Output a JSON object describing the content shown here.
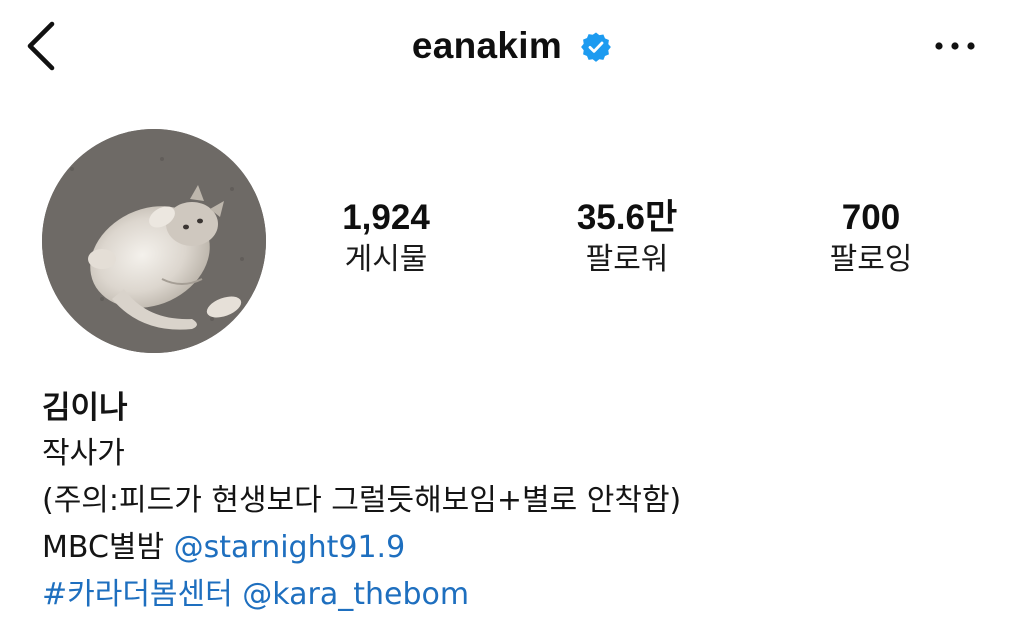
{
  "header": {
    "username": "eanakim",
    "verified_color": "#1d9bf0",
    "icons": {
      "back": "chevron-left-icon",
      "verified": "verified-badge-icon",
      "more": "more-horizontal-icon"
    }
  },
  "profile": {
    "avatar": "cat-photo"
  },
  "stats": [
    {
      "value": "1,924",
      "label": "게시물"
    },
    {
      "value": "35.6만",
      "label": "팔로워"
    },
    {
      "value": "700",
      "label": "팔로잉"
    }
  ],
  "bio": {
    "name": "김이나",
    "category": "작사가",
    "line3": "(주의:피드가 현생보다 그럴듯해보임+별로 안착함)",
    "line4_text": "MBC별밤 ",
    "line4_mention": "@starnight91.9",
    "line5_hashtag": "#카라더봄센터",
    "line5_mention": "@kara_thebom",
    "link_color": "#1e6fbf"
  }
}
